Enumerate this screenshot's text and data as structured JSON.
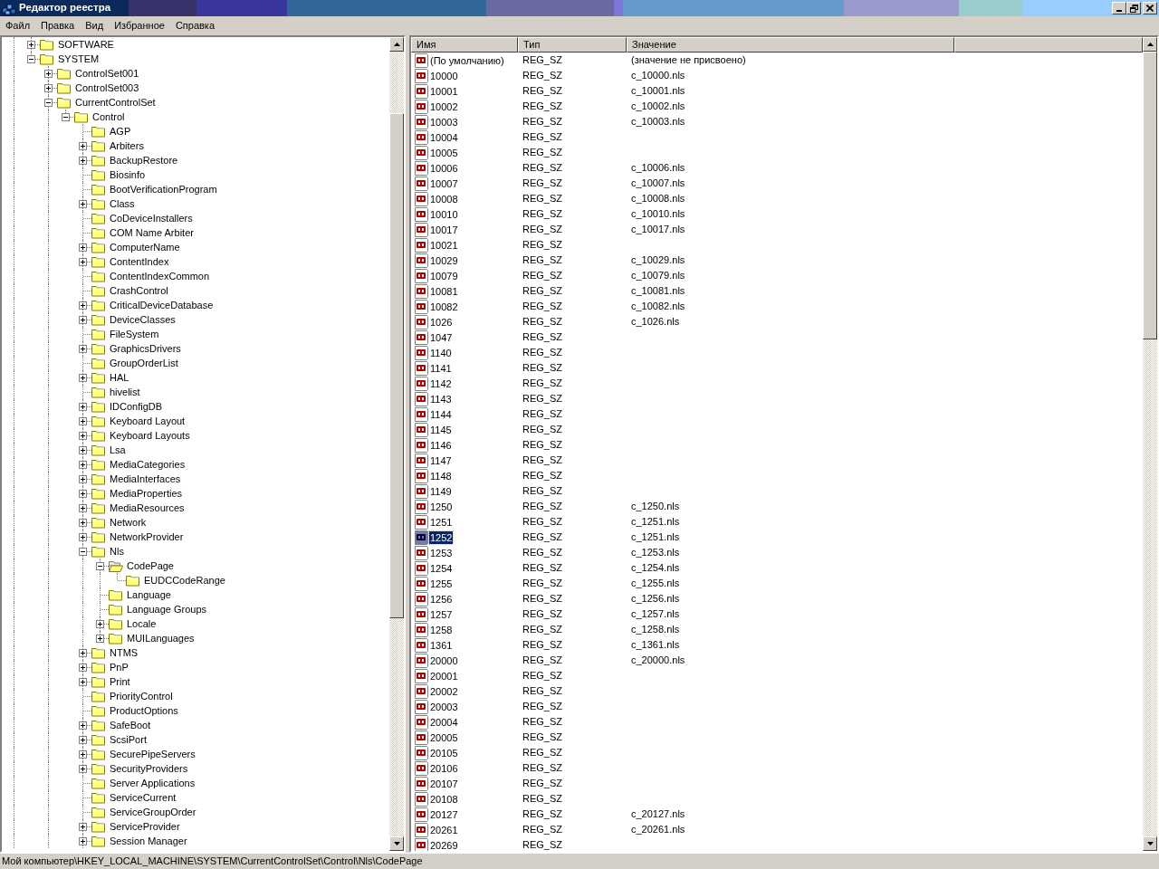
{
  "window": {
    "title": "Редактор реестра"
  },
  "menu": [
    "Файл",
    "Правка",
    "Вид",
    "Избранное",
    "Справка"
  ],
  "tree": [
    {
      "name": "SOFTWARE",
      "expanded": false,
      "selected": false
    },
    {
      "name": "SYSTEM",
      "expanded": true,
      "selected": false,
      "children": [
        {
          "name": "ControlSet001",
          "expanded": false,
          "selected": false
        },
        {
          "name": "ControlSet003",
          "expanded": false,
          "selected": false
        },
        {
          "name": "CurrentControlSet",
          "expanded": true,
          "selected": false,
          "continues": true,
          "children": [
            {
              "name": "Control",
              "expanded": true,
              "selected": false,
              "children": [
                {
                  "name": "AGP",
                  "selected": false
                },
                {
                  "name": "Arbiters",
                  "expanded": false,
                  "selected": false
                },
                {
                  "name": "BackupRestore",
                  "expanded": false,
                  "selected": false
                },
                {
                  "name": "Biosinfo",
                  "selected": false
                },
                {
                  "name": "BootVerificationProgram",
                  "selected": false
                },
                {
                  "name": "Class",
                  "expanded": false,
                  "selected": false
                },
                {
                  "name": "CoDeviceInstallers",
                  "selected": false
                },
                {
                  "name": "COM Name Arbiter",
                  "selected": false
                },
                {
                  "name": "ComputerName",
                  "expanded": false,
                  "selected": false
                },
                {
                  "name": "ContentIndex",
                  "expanded": false,
                  "selected": false
                },
                {
                  "name": "ContentIndexCommon",
                  "selected": false
                },
                {
                  "name": "CrashControl",
                  "selected": false
                },
                {
                  "name": "CriticalDeviceDatabase",
                  "expanded": false,
                  "selected": false
                },
                {
                  "name": "DeviceClasses",
                  "expanded": false,
                  "selected": false
                },
                {
                  "name": "FileSystem",
                  "selected": false
                },
                {
                  "name": "GraphicsDrivers",
                  "expanded": false,
                  "selected": false
                },
                {
                  "name": "GroupOrderList",
                  "selected": false
                },
                {
                  "name": "HAL",
                  "expanded": false,
                  "selected": false
                },
                {
                  "name": "hivelist",
                  "selected": false
                },
                {
                  "name": "IDConfigDB",
                  "expanded": false,
                  "selected": false
                },
                {
                  "name": "Keyboard Layout",
                  "expanded": false,
                  "selected": false
                },
                {
                  "name": "Keyboard Layouts",
                  "expanded": false,
                  "selected": false
                },
                {
                  "name": "Lsa",
                  "expanded": false,
                  "selected": false
                },
                {
                  "name": "MediaCategories",
                  "expanded": false,
                  "selected": false
                },
                {
                  "name": "MediaInterfaces",
                  "expanded": false,
                  "selected": false
                },
                {
                  "name": "MediaProperties",
                  "expanded": false,
                  "selected": false
                },
                {
                  "name": "MediaResources",
                  "expanded": false,
                  "selected": false
                },
                {
                  "name": "Network",
                  "expanded": false,
                  "selected": false
                },
                {
                  "name": "NetworkProvider",
                  "expanded": false,
                  "selected": false
                },
                {
                  "name": "Nls",
                  "expanded": true,
                  "selected": false,
                  "children": [
                    {
                      "name": "CodePage",
                      "expanded": true,
                      "selected": true,
                      "children": [
                        {
                          "name": "EUDCCodeRange",
                          "selected": false
                        }
                      ]
                    },
                    {
                      "name": "Language",
                      "selected": false
                    },
                    {
                      "name": "Language Groups",
                      "selected": false
                    },
                    {
                      "name": "Locale",
                      "expanded": false,
                      "selected": false
                    },
                    {
                      "name": "MUILanguages",
                      "expanded": false,
                      "selected": false
                    }
                  ]
                },
                {
                  "name": "NTMS",
                  "expanded": false,
                  "selected": false
                },
                {
                  "name": "PnP",
                  "expanded": false,
                  "selected": false
                },
                {
                  "name": "Print",
                  "expanded": false,
                  "selected": false
                },
                {
                  "name": "PriorityControl",
                  "selected": false
                },
                {
                  "name": "ProductOptions",
                  "selected": false
                },
                {
                  "name": "SafeBoot",
                  "expanded": false,
                  "selected": false
                },
                {
                  "name": "ScsiPort",
                  "expanded": false,
                  "selected": false
                },
                {
                  "name": "SecurePipeServers",
                  "expanded": false,
                  "selected": false
                },
                {
                  "name": "SecurityProviders",
                  "expanded": false,
                  "selected": false
                },
                {
                  "name": "Server Applications",
                  "selected": false
                },
                {
                  "name": "ServiceCurrent",
                  "selected": false
                },
                {
                  "name": "ServiceGroupOrder",
                  "selected": false
                },
                {
                  "name": "ServiceProvider",
                  "expanded": false,
                  "selected": false
                },
                {
                  "name": "Session Manager",
                  "expanded": false,
                  "selected": false,
                  "continues": true
                }
              ]
            }
          ]
        }
      ]
    }
  ],
  "columns": [
    "Имя",
    "Тип",
    "Значение"
  ],
  "rows": [
    {
      "name": "(По умолчанию)",
      "type": "REG_SZ",
      "value": "(значение не присвоено)",
      "selected": false
    },
    {
      "name": "10000",
      "type": "REG_SZ",
      "value": "c_10000.nls",
      "selected": false
    },
    {
      "name": "10001",
      "type": "REG_SZ",
      "value": "c_10001.nls",
      "selected": false
    },
    {
      "name": "10002",
      "type": "REG_SZ",
      "value": "c_10002.nls",
      "selected": false
    },
    {
      "name": "10003",
      "type": "REG_SZ",
      "value": "c_10003.nls",
      "selected": false
    },
    {
      "name": "10004",
      "type": "REG_SZ",
      "selected": false
    },
    {
      "name": "10005",
      "type": "REG_SZ",
      "selected": false
    },
    {
      "name": "10006",
      "type": "REG_SZ",
      "value": "c_10006.nls",
      "selected": false
    },
    {
      "name": "10007",
      "type": "REG_SZ",
      "value": "c_10007.nls",
      "selected": false
    },
    {
      "name": "10008",
      "type": "REG_SZ",
      "value": "c_10008.nls",
      "selected": false
    },
    {
      "name": "10010",
      "type": "REG_SZ",
      "value": "c_10010.nls",
      "selected": false
    },
    {
      "name": "10017",
      "type": "REG_SZ",
      "value": "c_10017.nls",
      "selected": false
    },
    {
      "name": "10021",
      "type": "REG_SZ",
      "selected": false
    },
    {
      "name": "10029",
      "type": "REG_SZ",
      "value": "c_10029.nls",
      "selected": false
    },
    {
      "name": "10079",
      "type": "REG_SZ",
      "value": "c_10079.nls",
      "selected": false
    },
    {
      "name": "10081",
      "type": "REG_SZ",
      "value": "c_10081.nls",
      "selected": false
    },
    {
      "name": "10082",
      "type": "REG_SZ",
      "value": "c_10082.nls",
      "selected": false
    },
    {
      "name": "1026",
      "type": "REG_SZ",
      "value": "c_1026.nls",
      "selected": false
    },
    {
      "name": "1047",
      "type": "REG_SZ",
      "selected": false
    },
    {
      "name": "1140",
      "type": "REG_SZ",
      "selected": false
    },
    {
      "name": "1141",
      "type": "REG_SZ",
      "selected": false
    },
    {
      "name": "1142",
      "type": "REG_SZ",
      "selected": false
    },
    {
      "name": "1143",
      "type": "REG_SZ",
      "selected": false
    },
    {
      "name": "1144",
      "type": "REG_SZ",
      "selected": false
    },
    {
      "name": "1145",
      "type": "REG_SZ",
      "selected": false
    },
    {
      "name": "1146",
      "type": "REG_SZ",
      "selected": false
    },
    {
      "name": "1147",
      "type": "REG_SZ",
      "selected": false
    },
    {
      "name": "1148",
      "type": "REG_SZ",
      "selected": false
    },
    {
      "name": "1149",
      "type": "REG_SZ",
      "selected": false
    },
    {
      "name": "1250",
      "type": "REG_SZ",
      "value": "c_1250.nls",
      "selected": false
    },
    {
      "name": "1251",
      "type": "REG_SZ",
      "value": "c_1251.nls",
      "selected": false
    },
    {
      "name": "1252",
      "type": "REG_SZ",
      "value": "c_1251.nls",
      "selected": true
    },
    {
      "name": "1253",
      "type": "REG_SZ",
      "value": "c_1253.nls",
      "selected": false
    },
    {
      "name": "1254",
      "type": "REG_SZ",
      "value": "c_1254.nls",
      "selected": false
    },
    {
      "name": "1255",
      "type": "REG_SZ",
      "value": "c_1255.nls",
      "selected": false
    },
    {
      "name": "1256",
      "type": "REG_SZ",
      "value": "c_1256.nls",
      "selected": false
    },
    {
      "name": "1257",
      "type": "REG_SZ",
      "value": "c_1257.nls",
      "selected": false
    },
    {
      "name": "1258",
      "type": "REG_SZ",
      "value": "c_1258.nls",
      "selected": false
    },
    {
      "name": "1361",
      "type": "REG_SZ",
      "value": "c_1361.nls",
      "selected": false
    },
    {
      "name": "20000",
      "type": "REG_SZ",
      "value": "c_20000.nls",
      "selected": false
    },
    {
      "name": "20001",
      "type": "REG_SZ",
      "selected": false
    },
    {
      "name": "20002",
      "type": "REG_SZ",
      "selected": false
    },
    {
      "name": "20003",
      "type": "REG_SZ",
      "selected": false
    },
    {
      "name": "20004",
      "type": "REG_SZ",
      "selected": false
    },
    {
      "name": "20005",
      "type": "REG_SZ",
      "selected": false
    },
    {
      "name": "20105",
      "type": "REG_SZ",
      "selected": false
    },
    {
      "name": "20106",
      "type": "REG_SZ",
      "selected": false
    },
    {
      "name": "20107",
      "type": "REG_SZ",
      "selected": false
    },
    {
      "name": "20108",
      "type": "REG_SZ",
      "selected": false
    },
    {
      "name": "20127",
      "type": "REG_SZ",
      "value": "c_20127.nls",
      "selected": false
    },
    {
      "name": "20261",
      "type": "REG_SZ",
      "value": "c_20261.nls",
      "selected": false
    },
    {
      "name": "20269",
      "type": "REG_SZ",
      "selected": false
    }
  ],
  "status_bar": "Мой компьютер\\HKEY_LOCAL_MACHINE\\SYSTEM\\CurrentControlSet\\Control\\Nls\\CodePage"
}
